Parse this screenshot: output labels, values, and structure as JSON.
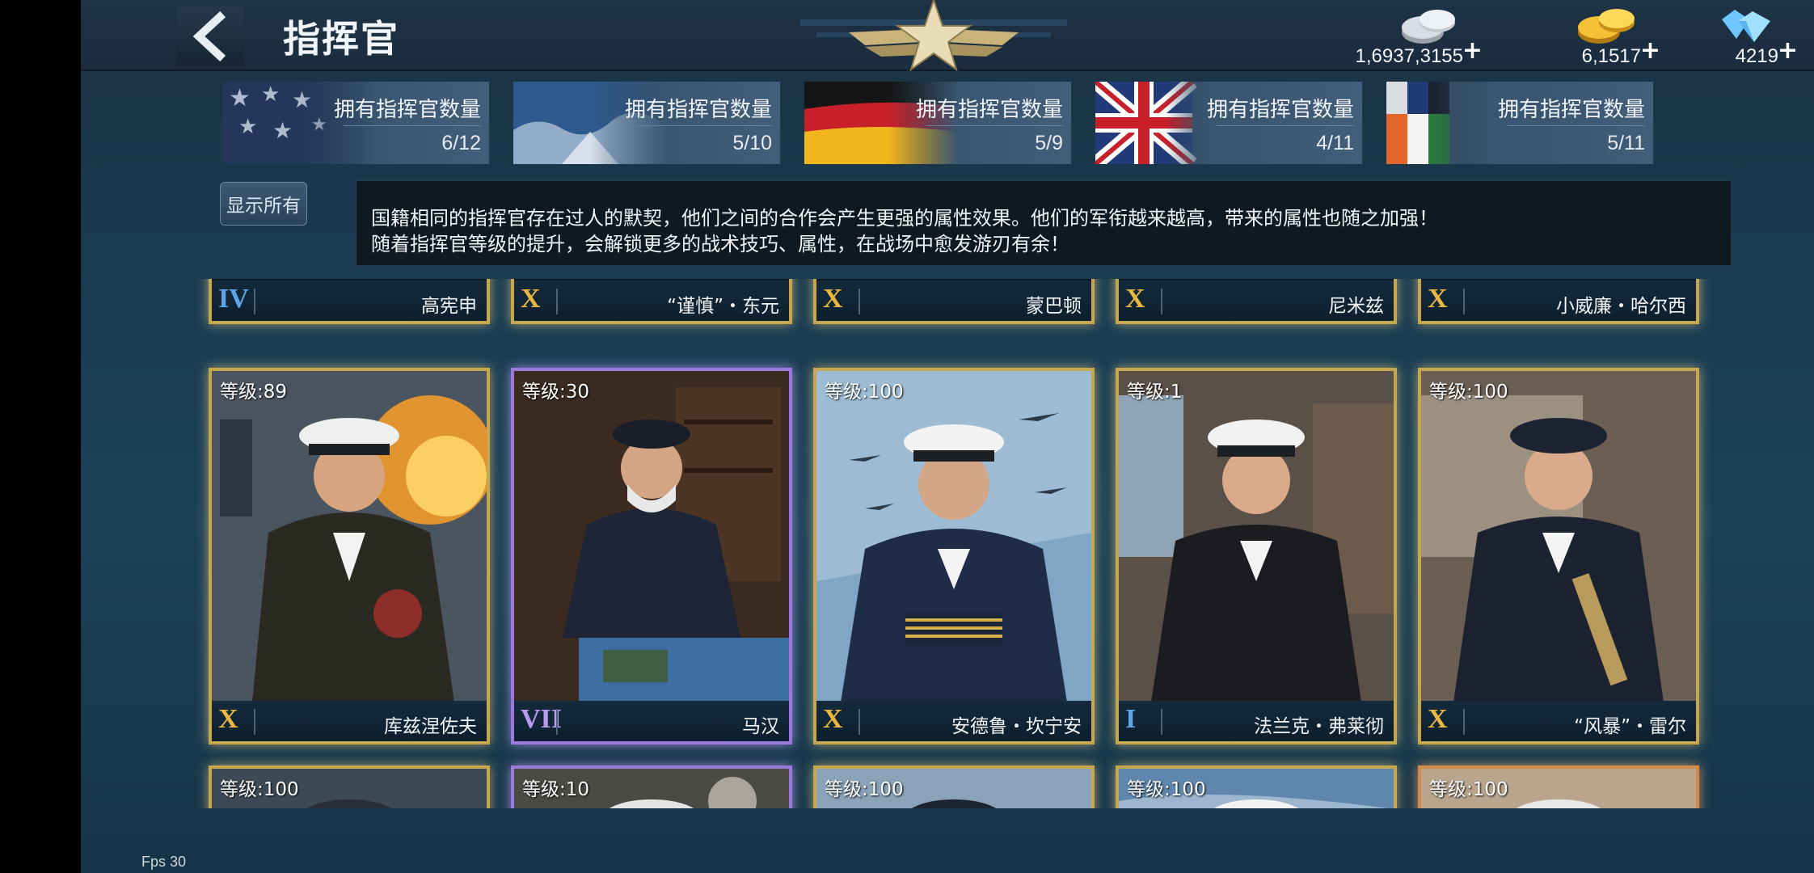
{
  "header": {
    "title": "指挥官",
    "back_icon": "back-arrow-icon",
    "emblem_icon": "winged-star-emblem-icon"
  },
  "currencies": [
    {
      "name": "silver-coins-icon",
      "value": "1,6937,3155",
      "plus": "+"
    },
    {
      "name": "gold-coins-icon",
      "value": "6,1517",
      "plus": "+"
    },
    {
      "name": "diamond-icon",
      "value": "4219",
      "plus": "+"
    }
  ],
  "nations": [
    {
      "flag": "usa-flag-icon",
      "title": "拥有指挥官数量",
      "count": "6/12"
    },
    {
      "flag": "japan-flag-icon",
      "title": "拥有指挥官数量",
      "count": "5/10"
    },
    {
      "flag": "germany-flag-icon",
      "title": "拥有指挥官数量",
      "count": "5/9"
    },
    {
      "flag": "uk-flag-icon",
      "title": "拥有指挥官数量",
      "count": "4/11"
    },
    {
      "flag": "soviet-flag-icon",
      "title": "拥有指挥官数量",
      "count": "5/11"
    }
  ],
  "show_all_label": "显示所有",
  "description": {
    "line1": "国籍相同的指挥官存在过人的默契，他们之间的合作会产生更强的属性效果。他们的军衔越来越高，带来的属性也随之加强！",
    "line2": "随着指挥官等级的提升，会解锁更多的战术技巧、属性，在战场中愈发游刃有余！"
  },
  "cards_row1": [
    {
      "rank": "IV",
      "name": "高宪申"
    },
    {
      "rank": "X",
      "name": "“谨慎”・东元"
    },
    {
      "rank": "X",
      "name": "蒙巴顿"
    },
    {
      "rank": "X",
      "name": "尼米兹"
    },
    {
      "rank": "X",
      "name": "小威廉・哈尔西"
    }
  ],
  "cards_row2": [
    {
      "level": "等级:89",
      "rank": "X",
      "name": "库兹涅佐夫"
    },
    {
      "level": "等级:30",
      "rank": "VII",
      "name": "马汉"
    },
    {
      "level": "等级:100",
      "rank": "X",
      "name": "安德鲁・坎宁安"
    },
    {
      "level": "等级:1",
      "rank": "I",
      "name": "法兰克・弗莱彻"
    },
    {
      "level": "等级:100",
      "rank": "X",
      "name": "“风暴”・雷尔"
    }
  ],
  "cards_row3": [
    {
      "level": "等级:100"
    },
    {
      "level": "等级:10"
    },
    {
      "level": "等级:100"
    },
    {
      "level": "等级:100"
    },
    {
      "level": "等级:100"
    }
  ],
  "fps": "Fps 30"
}
